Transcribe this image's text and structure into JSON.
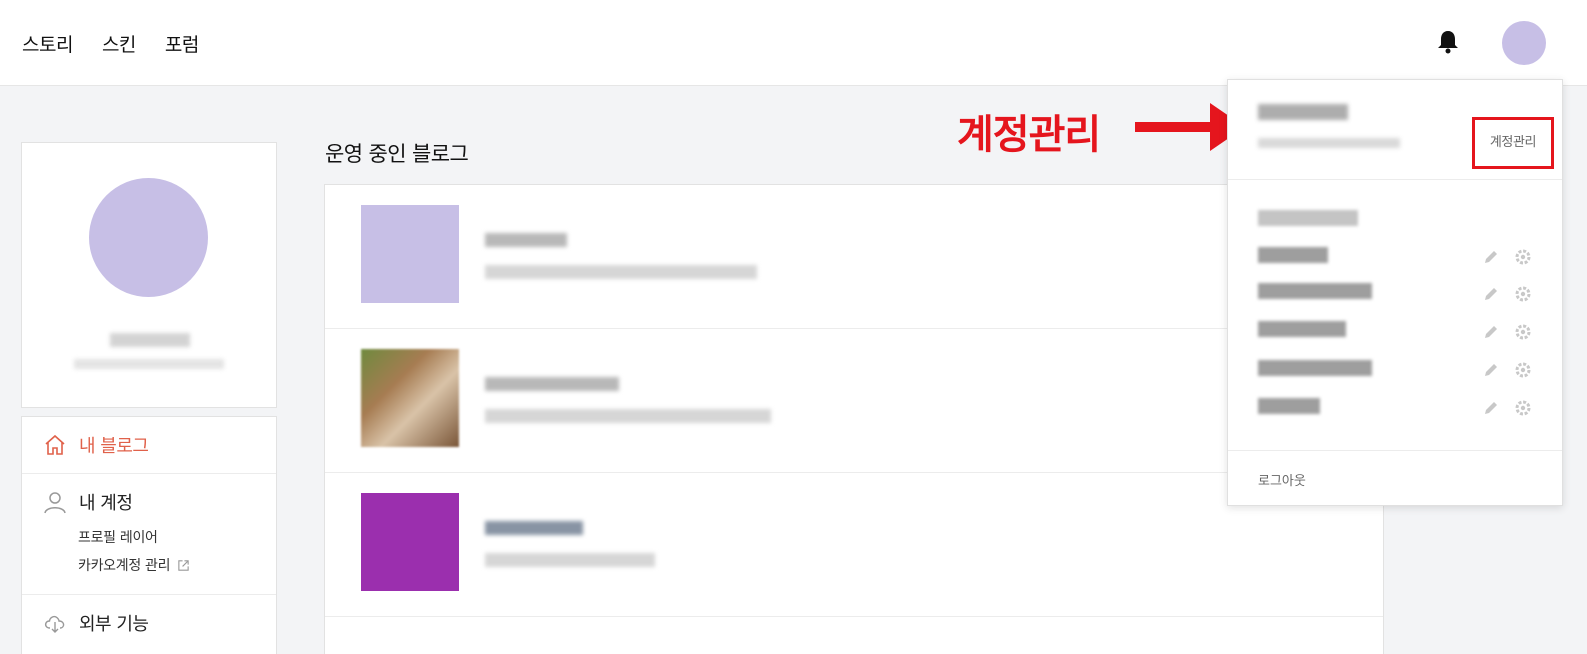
{
  "header": {
    "nav": [
      "스토리",
      "스킨",
      "포럼"
    ]
  },
  "sidebar": {
    "menu": {
      "my_blog": "내 블로그",
      "my_account": "내 계정",
      "profile_layer": "프로필 레이어",
      "kakao_account": "카카오계정 관리",
      "external": "외부 기능"
    }
  },
  "main": {
    "section_title": "운영 중인 블로그",
    "blogs": [
      {
        "thumb_color": "#c7bfe6"
      },
      {
        "thumb_color": "#8b6b4a"
      },
      {
        "thumb_color": "#9b2fae"
      }
    ]
  },
  "dropdown": {
    "account_manage": "계정관리",
    "logout": "로그아웃"
  },
  "annotation": {
    "label": "계정관리",
    "color": "#e5151d"
  },
  "colors": {
    "accent": "#e0614a",
    "avatar": "#c7bfe6"
  }
}
